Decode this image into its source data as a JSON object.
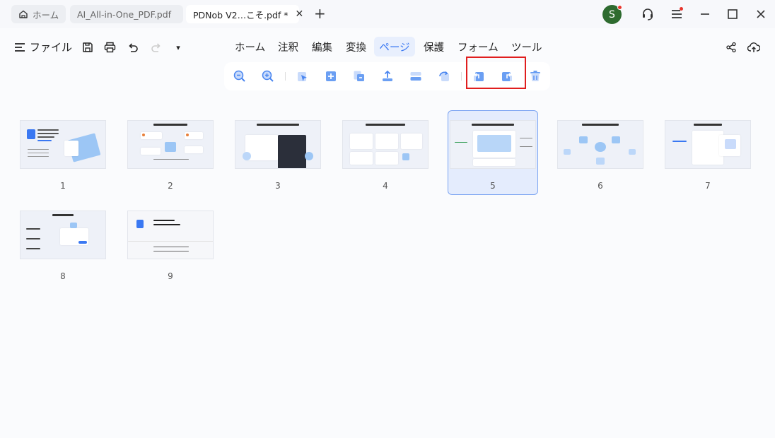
{
  "tabs": [
    {
      "label": "ホーム",
      "icon": "home-icon"
    },
    {
      "label": "AI_All-in-One_PDF.pdf"
    },
    {
      "label": "PDNob V2…こそ.pdf *",
      "close": "✕"
    }
  ],
  "new_tab": "+",
  "user": {
    "initial": "S"
  },
  "toolbar": {
    "file_label": "ファイル",
    "nav_tabs": [
      "ホーム",
      "注釈",
      "編集",
      "変換",
      "ページ",
      "保護",
      "フォーム",
      "ツール"
    ],
    "active_tab": "ページ",
    "redo_dropdown": "▾"
  },
  "subtoolbar_icons": [
    "zoom-out-icon",
    "zoom-in-icon",
    "select-page-icon",
    "insert-page-icon",
    "replace-page-icon",
    "extract-page-icon",
    "split-page-icon",
    "rotate-page-icon",
    "rotate-left-icon",
    "rotate-right-icon",
    "delete-page-icon"
  ],
  "pages": [
    {
      "num": "1"
    },
    {
      "num": "2"
    },
    {
      "num": "3"
    },
    {
      "num": "4"
    },
    {
      "num": "5"
    },
    {
      "num": "6"
    },
    {
      "num": "7"
    },
    {
      "num": "8"
    },
    {
      "num": "9"
    }
  ],
  "selected_page": "5",
  "colors": {
    "accent": "#3a78f2",
    "highlight": "#e01e1e",
    "avatar": "#2e6b2f"
  }
}
